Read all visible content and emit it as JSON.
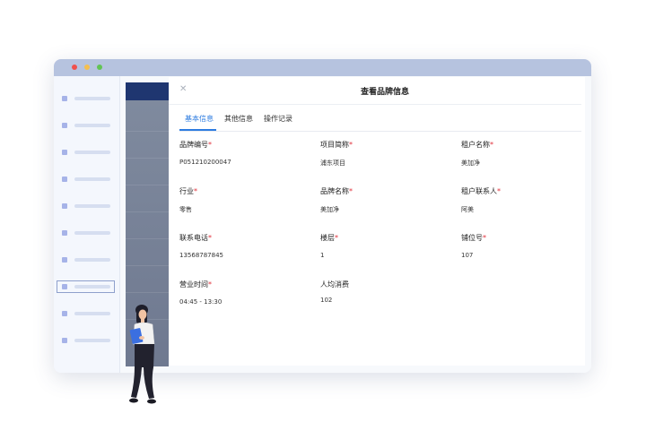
{
  "window": {
    "title_dots": [
      "close",
      "minimize",
      "maximize"
    ],
    "colors": {
      "titlebar": "#b6c3df",
      "accent": "#2e7ce0",
      "required": "#e0303a"
    }
  },
  "sidebar": {
    "item_count": 10,
    "active_index": 7
  },
  "panel": {
    "title": "查看品牌信息",
    "close_icon": "close-icon",
    "tabs": [
      {
        "label": "基本信息",
        "active": true
      },
      {
        "label": "其他信息",
        "active": false
      },
      {
        "label": "操作记录",
        "active": false
      }
    ],
    "fields": [
      {
        "label": "品牌编号",
        "required": "*",
        "value": "P051210200047"
      },
      {
        "label": "项目简称",
        "required": "*",
        "value": "浦东项目"
      },
      {
        "label": "租户名称",
        "required": "*",
        "value": "美加净"
      },
      {
        "label": "行业",
        "required": "*",
        "value": "零售"
      },
      {
        "label": "品牌名称",
        "required": "*",
        "value": "美加净"
      },
      {
        "label": "租户联系人",
        "required": "*",
        "value": "阿美"
      },
      {
        "label": "联系电话",
        "required": "*",
        "value": "13568787845"
      },
      {
        "label": "楼层",
        "required": "*",
        "value": "1"
      },
      {
        "label": "铺位号",
        "required": "*",
        "value": "107"
      },
      {
        "label": "营业时间",
        "required": "*",
        "value": "04:45 - 13:30"
      },
      {
        "label": "人均消费",
        "required": "",
        "value": "102"
      }
    ]
  }
}
